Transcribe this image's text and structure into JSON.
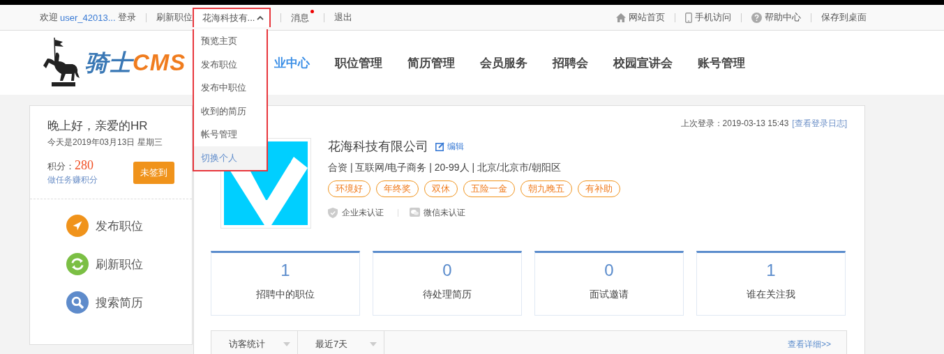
{
  "topbar": {
    "welcome": "欢迎",
    "user": "user_42013...",
    "login": "登录",
    "refresh": "刷新职位",
    "company_menu": {
      "label": "花海科技有...",
      "expanded": true,
      "items": [
        {
          "label": "预览主页",
          "selected": false
        },
        {
          "label": "发布职位",
          "selected": false
        },
        {
          "label": "发布中职位",
          "selected": false
        },
        {
          "label": "收到的简历",
          "selected": false
        },
        {
          "label": "帐号管理",
          "selected": false
        },
        {
          "label": "切换个人",
          "selected": true
        }
      ]
    },
    "messages": {
      "label": "消息",
      "unread": true
    },
    "logout": "退出",
    "right_links": [
      {
        "label": "网站首页",
        "kind": "home"
      },
      {
        "label": "手机访问",
        "kind": "phone"
      },
      {
        "label": "帮助中心",
        "kind": "help"
      },
      {
        "label": "保存到桌面",
        "kind": "plain"
      }
    ]
  },
  "logo": {
    "part1": "骑士",
    "part2": "CMS"
  },
  "nav": [
    {
      "label": "业中心",
      "selected": true
    },
    {
      "label": "职位管理",
      "selected": false
    },
    {
      "label": "简历管理",
      "selected": false
    },
    {
      "label": "会员服务",
      "selected": false
    },
    {
      "label": "招聘会",
      "selected": false
    },
    {
      "label": "校园宣讲会",
      "selected": false
    },
    {
      "label": "账号管理",
      "selected": false
    }
  ],
  "sidebar": {
    "greeting": "晚上好，亲爱的HR",
    "date": "今天是2019年03月13日   星期三",
    "points_label": "积分：",
    "points": "280",
    "earn_link": "做任务赚积分",
    "signin_button": "未签到",
    "actions": [
      {
        "label": "发布职位",
        "kind": "send",
        "color": "#f0931b"
      },
      {
        "label": "刷新职位",
        "kind": "refresh",
        "color": "#7bbf44"
      },
      {
        "label": "搜索简历",
        "kind": "search",
        "color": "#5e8bcb"
      }
    ]
  },
  "company": {
    "last_login": "上次登录：2019-03-13 15:43",
    "log_link": "[查看登录日志]",
    "name": "花海科技有限公司",
    "edit": "编辑",
    "info": "合资 | 互联网/电子商务 | 20-99人 | 北京/北京市/朝阳区",
    "tags": [
      "环境好",
      "年终奖",
      "双休",
      "五险一金",
      "朝九晚五",
      "有补助"
    ],
    "verifications": [
      {
        "label": "企业未认证",
        "kind": "company",
        "verified": false
      },
      {
        "label": "微信未认证",
        "kind": "wechat",
        "verified": false
      }
    ]
  },
  "stats": [
    {
      "value": "1",
      "label": "招聘中的职位"
    },
    {
      "value": "0",
      "label": "待处理简历"
    },
    {
      "value": "0",
      "label": "面试邀请"
    },
    {
      "value": "1",
      "label": "谁在关注我"
    }
  ],
  "visitor_bar": {
    "selects": [
      "访客统计",
      "最近7天"
    ],
    "detail_link": "查看详细>>"
  }
}
